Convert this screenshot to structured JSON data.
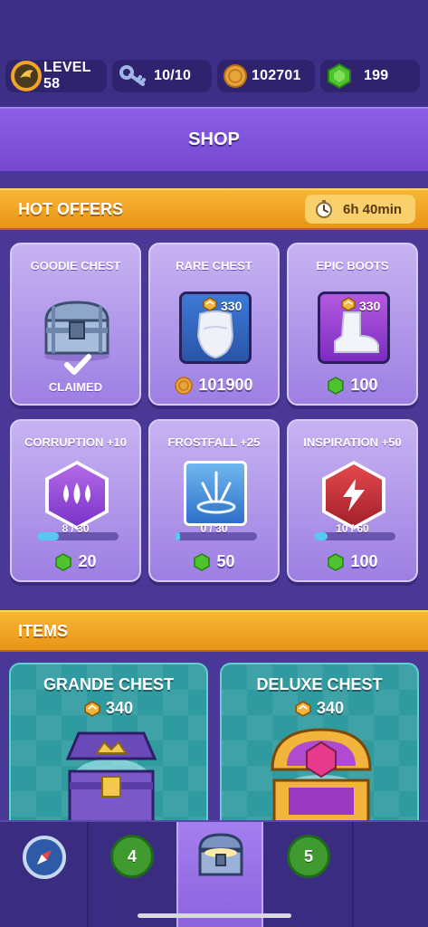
{
  "stats": {
    "level": "LEVEL 58",
    "keys": "10/10",
    "gold": "102701",
    "gems": "199"
  },
  "header": {
    "title": "SHOP"
  },
  "hot_offers": {
    "title": "HOT OFFERS",
    "timer": "6h 40min",
    "cards": [
      {
        "title": "GOODIE CHEST",
        "status": "CLAIMED"
      },
      {
        "title": "RARE CHEST",
        "fragments": "330",
        "price": "101900",
        "currency": "gold"
      },
      {
        "title": "EPIC BOOTS",
        "fragments": "330",
        "price": "100",
        "currency": "gem"
      },
      {
        "title": "CORRUPTION +10",
        "progress_text": "8 / 30",
        "progress": 0.267,
        "price": "20",
        "currency": "gem"
      },
      {
        "title": "FROSTFALL +25",
        "progress_text": "0 / 30",
        "progress": 0.0,
        "price": "50",
        "currency": "gem"
      },
      {
        "title": "INSPIRATION +50",
        "progress_text": "10 / 60",
        "progress": 0.167,
        "price": "100",
        "currency": "gem"
      }
    ]
  },
  "items": {
    "title": "ITEMS",
    "cards": [
      {
        "title": "GRANDE CHEST",
        "cost": "340"
      },
      {
        "title": "DELUXE CHEST",
        "cost": "340"
      }
    ]
  },
  "navbar": {
    "badges": [
      "4",
      "5"
    ],
    "icons": [
      "compass-icon",
      "chest-icon"
    ]
  },
  "colors": {
    "background": "#4a3896",
    "accent_orange": "#f0a526",
    "gem_green": "#4fc32e",
    "gold": "#e9a43a"
  }
}
